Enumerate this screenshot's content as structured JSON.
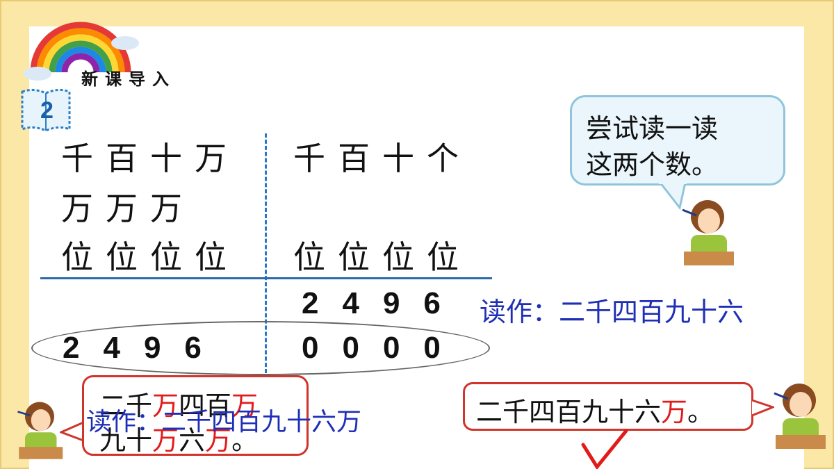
{
  "slide": {
    "section_title": "新课导入",
    "page_badge": "2"
  },
  "place_value_table": {
    "left_headers_row1": "千百十万",
    "left_headers_row2": "万万万",
    "left_headers_row3": "位位位位",
    "right_headers_row1": "千百十个",
    "right_headers_row3": "位位位位",
    "number_small": "2496",
    "number_large_left": "2496",
    "number_large_right": "0000"
  },
  "reading_small": "读作：二千四百九十六",
  "reading_large_blue": "读作：二千四百九十六万",
  "bubble_prompt": {
    "line1": "尝试读一读",
    "line2": "这两个数。"
  },
  "wrong_answer": {
    "line1_parts": [
      "二千",
      "万",
      "四百",
      "万"
    ],
    "line2_parts": [
      "九十",
      "万",
      "六",
      "万",
      "。"
    ]
  },
  "right_answer": {
    "parts": [
      "二千四百九十六",
      "万",
      "。"
    ]
  },
  "colors": {
    "background": "#fbe7a6",
    "reading_blue": "#1e2fb6",
    "highlight_red": "#e21a1a",
    "divider_blue": "#2b78c8"
  }
}
